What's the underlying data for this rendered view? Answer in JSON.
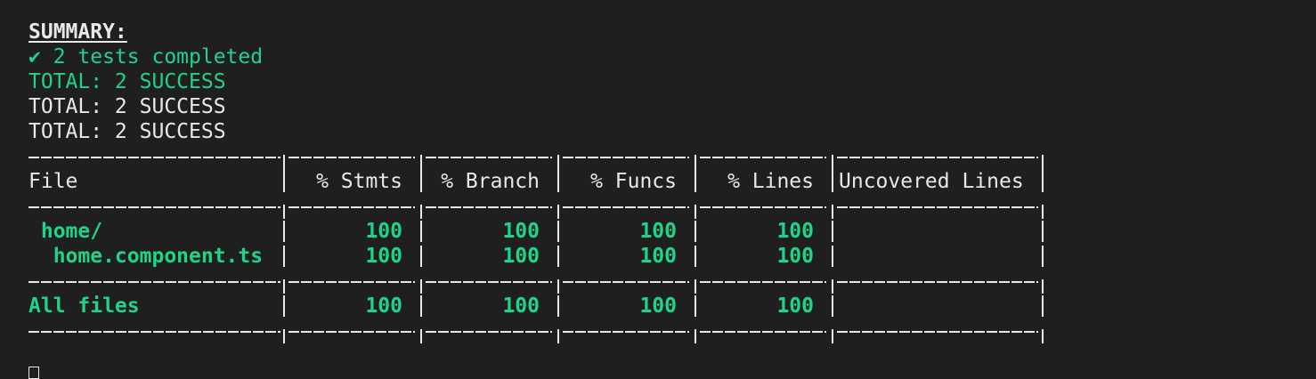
{
  "summary": {
    "title": "SUMMARY:",
    "completed": "✔ 2 tests completed",
    "total_lines": [
      "TOTAL: 2 SUCCESS",
      "TOTAL: 2 SUCCESS",
      "TOTAL: 2 SUCCESS"
    ]
  },
  "coverage_table": {
    "headers": [
      "File",
      "% Stmts",
      "% Branch",
      "% Funcs",
      "% Lines",
      "Uncovered Lines"
    ],
    "rows": [
      {
        "file": " home/",
        "stmts": "100",
        "branch": "100",
        "funcs": "100",
        "lines": "100",
        "uncovered": ""
      },
      {
        "file": "  home.component.ts",
        "stmts": "100",
        "branch": "100",
        "funcs": "100",
        "lines": "100",
        "uncovered": ""
      }
    ],
    "all_files": {
      "file": "All files",
      "stmts": "100",
      "branch": "100",
      "funcs": "100",
      "lines": "100",
      "uncovered": ""
    }
  },
  "colors": {
    "background": "#1f1f1f",
    "text": "#e8e8e8",
    "success": "#1ed38a"
  }
}
